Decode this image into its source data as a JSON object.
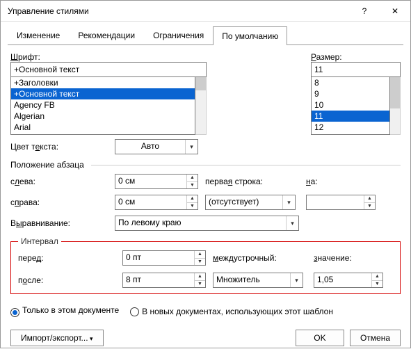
{
  "title": "Управление стилями",
  "tabs": {
    "t0": "Изменение",
    "t1": "Рекомендации",
    "t2": "Ограничения",
    "t3": "По умолчанию"
  },
  "font": {
    "label_html": "<span class='underline'>Ш</span>рифт:",
    "value": "+Основной текст",
    "items": [
      "+Заголовки",
      "+Основной текст",
      "Agency FB",
      "Algerian",
      "Arial"
    ]
  },
  "size": {
    "label_html": "<span class='underline'>Р</span>азмер:",
    "value": "11",
    "items": [
      "8",
      "9",
      "10",
      "11",
      "12"
    ]
  },
  "textcolor": {
    "label_html": "Цвет т<span class='underline'>е</span>кста:",
    "value": "Авто"
  },
  "paragraph": {
    "heading": "Положение абзаца",
    "left_html": "с<span class='underline'>л</span>ева:",
    "left_val": "0 см",
    "right_html": "с<span class='underline'>п</span>рава:",
    "right_val": "0 см",
    "align_html": "В<span class='underline'>ы</span>равнивание:",
    "align_val": "По левому краю",
    "firstline_html": "перва<span class='underline'>я</span> строка:",
    "firstline_val": "(отсутствует)",
    "by_html": "<span class='underline'>н</span>а:",
    "by_val": ""
  },
  "interval": {
    "heading": "Интервал",
    "before_html": "пере<span class='underline'>д</span>:",
    "before_val": "0 пт",
    "after_html": "п<span class='underline'>о</span>сле:",
    "after_val": "8 пт",
    "linespacing_html": "<span class='underline'>м</span>еждустрочный:",
    "linespacing_val": "Множитель",
    "at_html": "<span class='underline'>з</span>начение:",
    "at_val": "1,05"
  },
  "scope": {
    "thisdoc": "Только в этом документе",
    "newdocs": "В новых документах, использующих этот шаблон"
  },
  "footer": {
    "import": "Импорт/экспорт...",
    "ok": "OK",
    "cancel": "Отмена"
  }
}
